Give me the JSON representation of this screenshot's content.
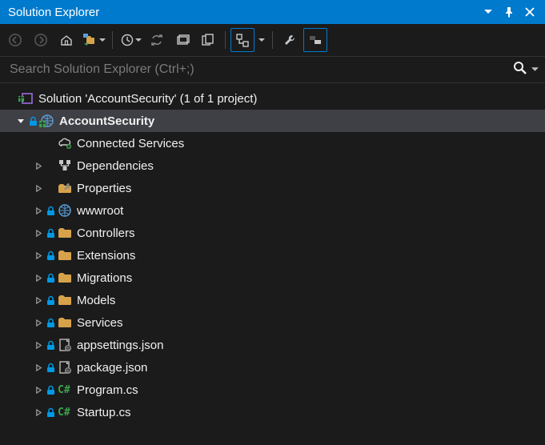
{
  "panel": {
    "title": "Solution Explorer"
  },
  "search": {
    "placeholder": "Search Solution Explorer (Ctrl+;)"
  },
  "tree": {
    "solution": {
      "label": "Solution 'AccountSecurity' (1 of 1 project)",
      "project": {
        "label": "AccountSecurity",
        "items": [
          {
            "name": "connected-services",
            "label": "Connected Services",
            "icon": "cloud",
            "expandable": false,
            "locked": false
          },
          {
            "name": "dependencies",
            "label": "Dependencies",
            "icon": "deps",
            "expandable": true,
            "locked": false
          },
          {
            "name": "properties",
            "label": "Properties",
            "icon": "wrench-folder",
            "expandable": true,
            "locked": false
          },
          {
            "name": "wwwroot",
            "label": "wwwroot",
            "icon": "globe",
            "expandable": true,
            "locked": true
          },
          {
            "name": "controllers",
            "label": "Controllers",
            "icon": "folder",
            "expandable": true,
            "locked": true
          },
          {
            "name": "extensions",
            "label": "Extensions",
            "icon": "folder",
            "expandable": true,
            "locked": true
          },
          {
            "name": "migrations",
            "label": "Migrations",
            "icon": "folder",
            "expandable": true,
            "locked": true
          },
          {
            "name": "models",
            "label": "Models",
            "icon": "folder",
            "expandable": true,
            "locked": true
          },
          {
            "name": "services",
            "label": "Services",
            "icon": "folder",
            "expandable": true,
            "locked": true
          },
          {
            "name": "appsettings-json",
            "label": "appsettings.json",
            "icon": "json",
            "expandable": true,
            "locked": true
          },
          {
            "name": "package-json",
            "label": "package.json",
            "icon": "json",
            "expandable": true,
            "locked": true
          },
          {
            "name": "program-cs",
            "label": "Program.cs",
            "icon": "cs",
            "expandable": true,
            "locked": true
          },
          {
            "name": "startup-cs",
            "label": "Startup.cs",
            "icon": "cs",
            "expandable": true,
            "locked": true
          }
        ]
      }
    }
  },
  "colors": {
    "accent": "#007acc",
    "folder": "#d6a24a",
    "cs": "#3ea24e",
    "lock": "#0099e5"
  }
}
